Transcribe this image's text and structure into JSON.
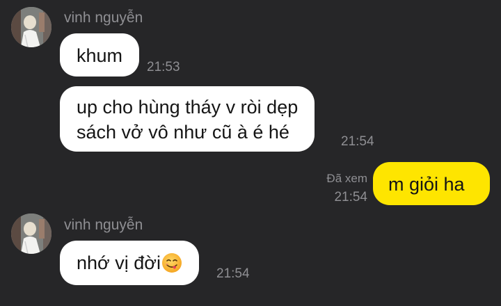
{
  "conversation": {
    "messages": [
      {
        "sender": "vinh nguyễn",
        "text": "khum",
        "time": "21:53"
      },
      {
        "lines": [
          "up cho hùng tháy v ròi dẹp",
          "sách vở vô như cũ à é hé"
        ],
        "time": "21:54"
      },
      {
        "text": "m giỏi ha",
        "seen_label": "Đã xem",
        "time": "21:54"
      },
      {
        "sender": "vinh nguyễn",
        "text": "nhớ vị đời",
        "emoji": "face-savoring-food-emoji",
        "time": "21:54"
      }
    ]
  },
  "colors": {
    "background": "#262628",
    "incoming_bubble": "#ffffff",
    "outgoing_bubble": "#fee500",
    "meta_text": "#8f8f93"
  }
}
